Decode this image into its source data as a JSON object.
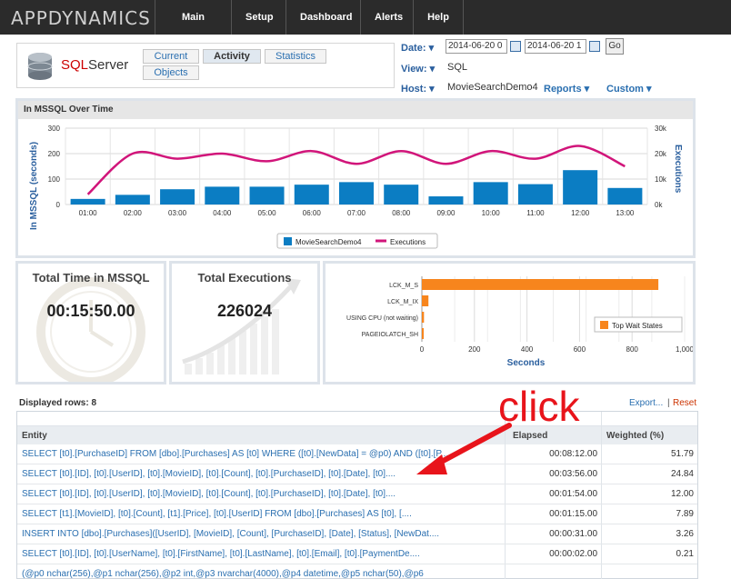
{
  "brand": "APPDYNAMICS",
  "nav": [
    "Main Menu",
    "Setup",
    "Dashboard",
    "Alerts",
    "Help"
  ],
  "app": {
    "title_sql": "SQL",
    "title_server": "Server"
  },
  "tabs": [
    "Current",
    "Activity",
    "Statistics",
    "Objects"
  ],
  "header": {
    "date_label": "Date:",
    "date_from": "2014-06-20 0",
    "date_to": "2014-06-20 1",
    "go": "Go",
    "view_label": "View:",
    "view_value": "SQL",
    "host_label": "Host:",
    "host_value": "MovieSearchDemo4",
    "reports": "Reports",
    "custom": "Custom"
  },
  "chart_main": {
    "panel_title": "In MSSQL Over Time",
    "ylabel_left": "In MSSQL (seconds)",
    "ylabel_right": "Executions",
    "legend": [
      "MovieSearchDemo4",
      "Executions"
    ]
  },
  "chart_data": [
    {
      "type": "bar+line",
      "title": "In MSSQL Over Time",
      "categories": [
        "01:00",
        "02:00",
        "03:00",
        "04:00",
        "05:00",
        "06:00",
        "07:00",
        "08:00",
        "09:00",
        "10:00",
        "11:00",
        "12:00",
        "13:00"
      ],
      "series": [
        {
          "name": "MovieSearchDemo4",
          "type": "bar",
          "axis": "left",
          "values": [
            22,
            38,
            60,
            70,
            70,
            78,
            88,
            78,
            32,
            88,
            80,
            135,
            65
          ]
        },
        {
          "name": "Executions",
          "type": "line",
          "axis": "right",
          "values": [
            4000,
            20000,
            18000,
            20000,
            17000,
            21000,
            16000,
            21000,
            16000,
            21000,
            18000,
            23000,
            15000
          ]
        }
      ],
      "ylabel": "In MSSQL (seconds)",
      "y2label": "Executions",
      "ylim": [
        0,
        300
      ],
      "y2lim": [
        0,
        30000
      ],
      "yticks": [
        "0",
        "100",
        "200",
        "300"
      ],
      "y2ticks": [
        "0k",
        "10k",
        "20k",
        "30k"
      ],
      "legend_position": "bottom",
      "colors": {
        "bar": "#0b7dc3",
        "line": "#d1157a"
      }
    },
    {
      "type": "bar",
      "orientation": "horizontal",
      "categories": [
        "LCK_M_S",
        "LCK_M_IX",
        "USING CPU (not waiting)",
        "PAGEIOLATCH_SH"
      ],
      "values": [
        900,
        25,
        8,
        5
      ],
      "xlabel": "Seconds",
      "xticks": [
        "0",
        "200",
        "400",
        "600",
        "800",
        "1,000"
      ],
      "xlim": [
        0,
        1000
      ],
      "legend": "Top Wait States",
      "legend_position": "right",
      "color": "#f7851d"
    }
  ],
  "stats": {
    "total_time_label": "Total Time in MSSQL",
    "total_time_value": "00:15:50.00",
    "total_exec_label": "Total Executions",
    "total_exec_value": "226024"
  },
  "table": {
    "displayed_rows": "Displayed rows: 8",
    "export": "Export...",
    "sep": "|",
    "reset": "Reset",
    "headers": [
      "Entity",
      "Elapsed",
      "Weighted (%)"
    ],
    "rows": [
      {
        "entity": "SELECT [t0].[PurchaseID] FROM [dbo].[Purchases] AS [t0] WHERE ([t0].[NewData] = @p0) AND ([t0].[P...",
        "elapsed": "00:08:12.00",
        "weighted": "51.79"
      },
      {
        "entity": "SELECT [t0].[ID], [t0].[UserID], [t0].[MovieID], [t0].[Count], [t0].[PurchaseID], [t0].[Date], [t0]....",
        "elapsed": "00:03:56.00",
        "weighted": "24.84"
      },
      {
        "entity": "SELECT [t0].[ID], [t0].[UserID], [t0].[MovieID], [t0].[Count], [t0].[PurchaseID], [t0].[Date], [t0]....",
        "elapsed": "00:01:54.00",
        "weighted": "12.00"
      },
      {
        "entity": "SELECT [t1].[MovieID], [t0].[Count], [t1].[Price], [t0].[UserID] FROM [dbo].[Purchases] AS [t0], [....",
        "elapsed": "00:01:15.00",
        "weighted": "7.89"
      },
      {
        "entity": "INSERT INTO [dbo].[Purchases]([UserID], [MovieID], [Count], [PurchaseID], [Date], [Status], [NewDat....",
        "elapsed": "00:00:31.00",
        "weighted": "3.26"
      },
      {
        "entity": "SELECT [t0].[ID], [t0].[UserName], [t0].[FirstName], [t0].[LastName], [t0].[Email], [t0].[PaymentDe....",
        "elapsed": "00:00:02.00",
        "weighted": "0.21"
      },
      {
        "entity": "(@p0 nchar(256),@p1 nchar(256),@p2 int,@p3 nvarchar(4000),@p4 datetime,@p5 nchar(50),@p6",
        "elapsed": "",
        "weighted": ""
      }
    ]
  },
  "annotation": {
    "click": "click",
    "color": "#e8141b"
  }
}
